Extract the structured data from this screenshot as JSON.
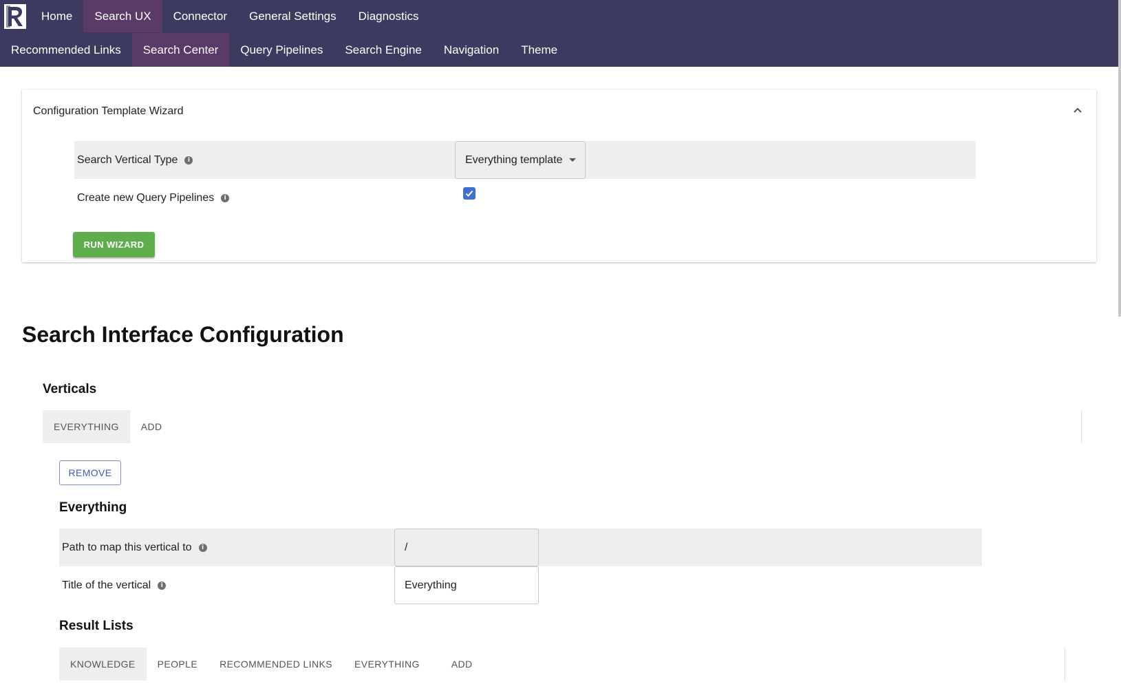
{
  "topnav": {
    "row1": [
      {
        "label": "Home",
        "active": false
      },
      {
        "label": "Search UX",
        "active": true
      },
      {
        "label": "Connector",
        "active": false
      },
      {
        "label": "General Settings",
        "active": false
      },
      {
        "label": "Diagnostics",
        "active": false
      }
    ],
    "row2": [
      {
        "label": "Recommended Links",
        "active": false
      },
      {
        "label": "Search Center",
        "active": true
      },
      {
        "label": "Query Pipelines",
        "active": false
      },
      {
        "label": "Search Engine",
        "active": false
      },
      {
        "label": "Navigation",
        "active": false
      },
      {
        "label": "Theme",
        "active": false
      }
    ]
  },
  "wizard": {
    "title": "Configuration Template Wizard",
    "vertical_type_label": "Search Vertical Type",
    "vertical_type_value": "Everything template",
    "create_pipelines_label": "Create new Query Pipelines",
    "create_pipelines_checked": true,
    "run_button": "RUN WIZARD"
  },
  "main": {
    "page_title": "Search Interface Configuration",
    "verticals_title": "Verticals",
    "vertical_tabs": [
      {
        "label": "EVERYTHING",
        "active": true
      },
      {
        "label": "ADD",
        "active": false
      }
    ],
    "remove_button": "REMOVE",
    "vertical_name": "Everything",
    "path_label": "Path to map this vertical to",
    "path_value": "/",
    "title_label": "Title of the vertical",
    "title_value": "Everything",
    "result_lists_title": "Result Lists",
    "result_tabs": [
      {
        "label": "KNOWLEDGE",
        "active": true
      },
      {
        "label": "PEOPLE",
        "active": false
      },
      {
        "label": "RECOMMENDED LINKS",
        "active": false
      },
      {
        "label": "EVERYTHING",
        "active": false
      },
      {
        "label": "ADD",
        "active": false
      }
    ]
  },
  "icons": {
    "logo": "brand-logo-icon",
    "collapse": "chevron-up-icon",
    "info": "info-icon",
    "dropdown": "caret-down-icon",
    "checkbox": "checkmark-icon"
  },
  "colors": {
    "topbar": "#3d3a5f",
    "nav_active": "#5a3a66",
    "run_button": "#5fae4e",
    "checkbox": "#3d6fd4",
    "remove_button_text": "#3d5ab8"
  }
}
